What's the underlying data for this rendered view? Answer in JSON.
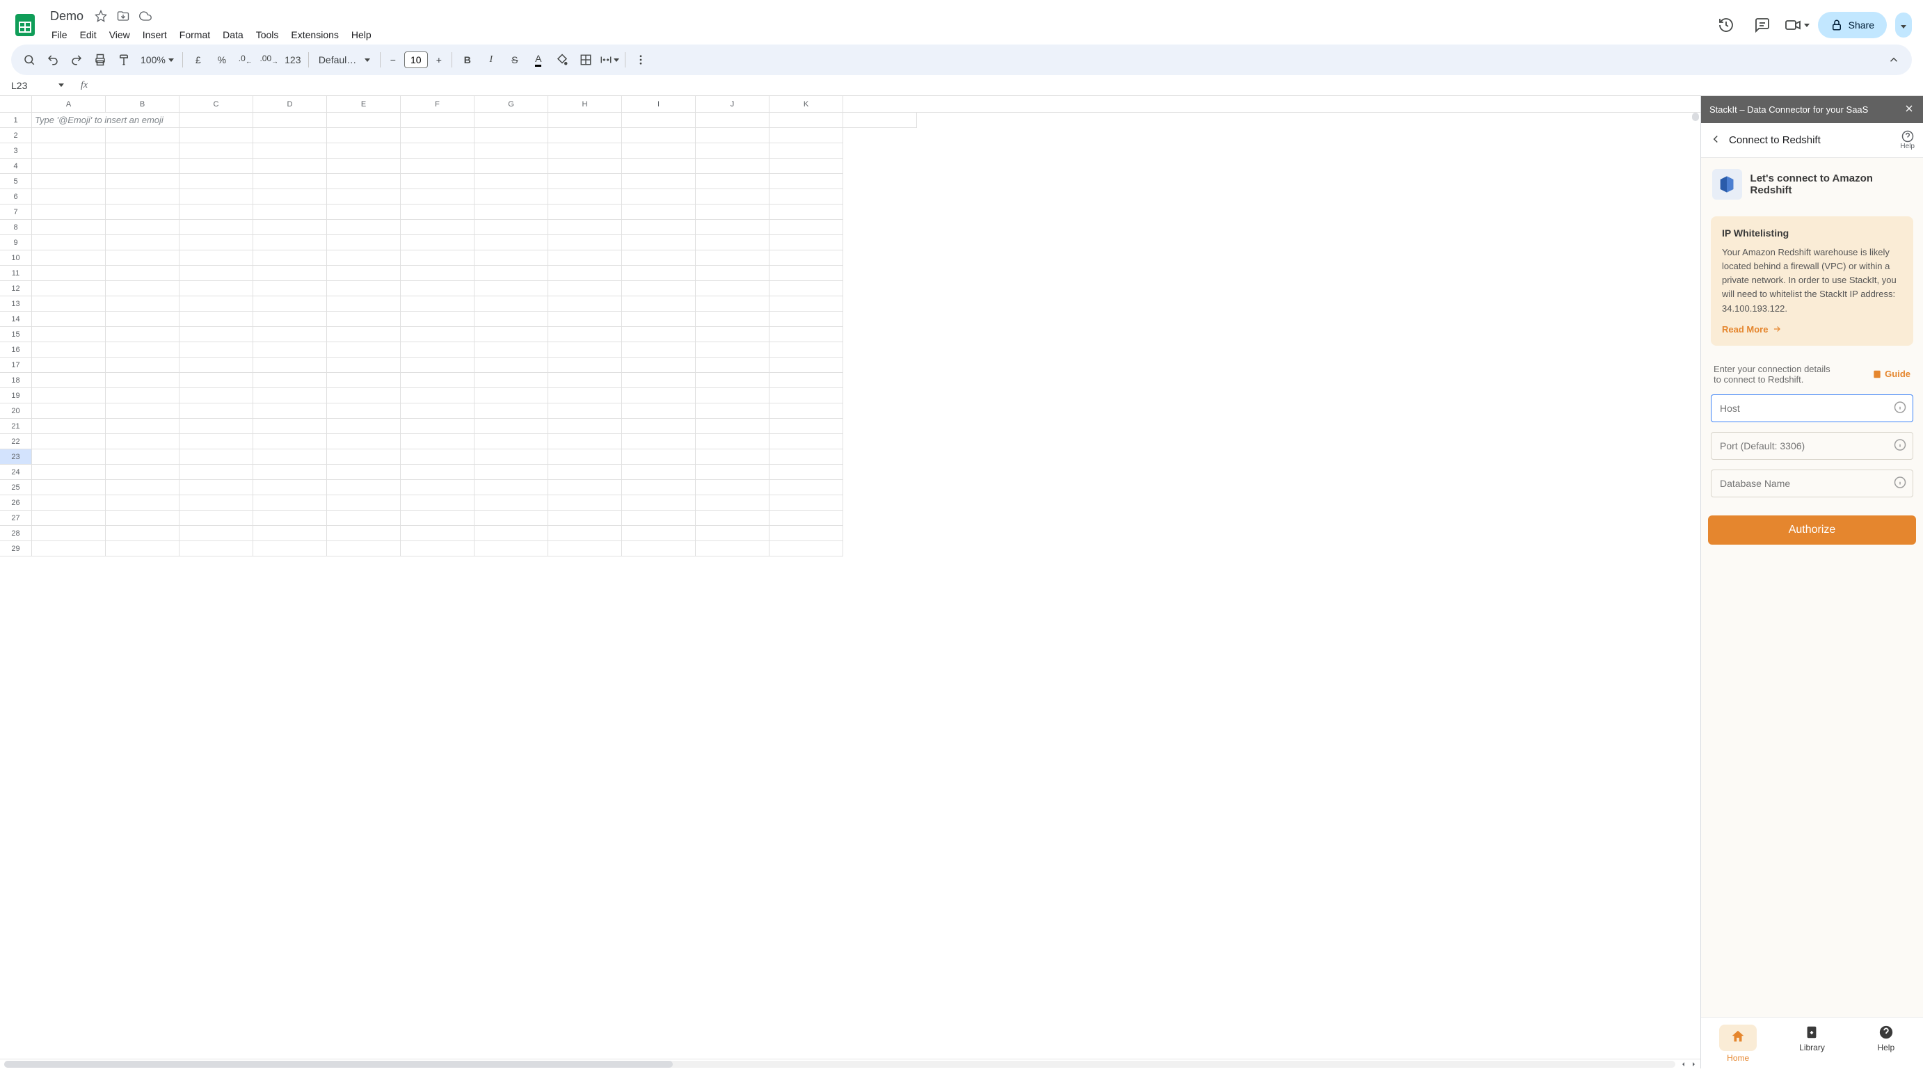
{
  "header": {
    "doc_title": "Demo",
    "menus": [
      "File",
      "Edit",
      "View",
      "Insert",
      "Format",
      "Data",
      "Tools",
      "Extensions",
      "Help"
    ],
    "share_label": "Share"
  },
  "toolbar": {
    "zoom": "100%",
    "font": "Defaul…",
    "font_size": "10",
    "number_format": "123"
  },
  "namebox": {
    "cell_ref": "L23"
  },
  "grid": {
    "columns": [
      "A",
      "B",
      "C",
      "D",
      "E",
      "F",
      "G",
      "H",
      "I",
      "J",
      "K"
    ],
    "rows": 29,
    "selected_row": 23,
    "placeholder_a1": "Type '@Emoji' to insert an emoji"
  },
  "addon": {
    "titlebar": "StackIt – Data Connector for your SaaS",
    "sub_title": "Connect to Redshift",
    "help_label": "Help",
    "connect_heading": "Let's connect to Amazon Redshift",
    "whitelist": {
      "title": "IP Whitelisting",
      "body": "Your Amazon Redshift warehouse is likely located behind a firewall (VPC) or within a private network. In order to use StackIt, you will need to whitelist the StackIt IP address: 34.100.193.122.",
      "readmore": "Read More"
    },
    "prompt": "Enter your connection details to connect to Redshift.",
    "guide_label": "Guide",
    "fields": {
      "host_placeholder": "Host",
      "port_placeholder": "Port (Default: 3306)",
      "db_placeholder": "Database Name"
    },
    "authorize": "Authorize",
    "nav": {
      "home": "Home",
      "library": "Library",
      "help": "Help"
    }
  }
}
